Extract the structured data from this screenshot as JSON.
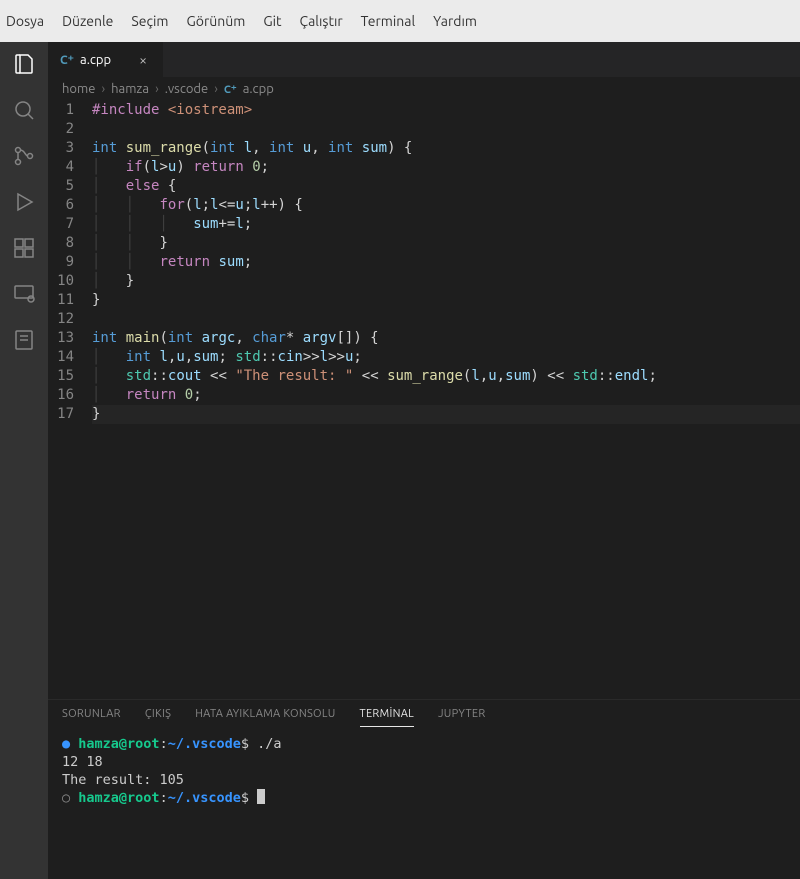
{
  "menubar": [
    "Dosya",
    "Düzenle",
    "Seçim",
    "Görünüm",
    "Git",
    "Çalıştır",
    "Terminal",
    "Yardım"
  ],
  "tab": {
    "icon_label": "C⁺",
    "filename": "a.cpp"
  },
  "breadcrumbs": {
    "parts": [
      "home",
      "hamza",
      ".vscode"
    ],
    "icon_label": "C⁺",
    "file": "a.cpp"
  },
  "code": {
    "line_count": 17,
    "lines": [
      [
        [
          "pp",
          "#include "
        ],
        [
          "inc",
          "<iostream>"
        ]
      ],
      [],
      [
        [
          "kw",
          "int "
        ],
        [
          "fn",
          "sum_range"
        ],
        [
          "pun",
          "("
        ],
        [
          "kw",
          "int "
        ],
        [
          "var",
          "l"
        ],
        [
          "pun",
          ", "
        ],
        [
          "kw",
          "int "
        ],
        [
          "var",
          "u"
        ],
        [
          "pun",
          ", "
        ],
        [
          "kw",
          "int "
        ],
        [
          "var",
          "sum"
        ],
        [
          "pun",
          ") {"
        ]
      ],
      [
        [
          "ws",
          "    "
        ],
        [
          "ctrl",
          "if"
        ],
        [
          "pun",
          "("
        ],
        [
          "var",
          "l"
        ],
        [
          "op",
          ">"
        ],
        [
          "var",
          "u"
        ],
        [
          "pun",
          ") "
        ],
        [
          "ctrl",
          "return"
        ],
        [
          "pun",
          " "
        ],
        [
          "num",
          "0"
        ],
        [
          "pun",
          ";"
        ]
      ],
      [
        [
          "ws",
          "    "
        ],
        [
          "ctrl",
          "else"
        ],
        [
          "pun",
          " {"
        ]
      ],
      [
        [
          "ws",
          "        "
        ],
        [
          "ctrl",
          "for"
        ],
        [
          "pun",
          "("
        ],
        [
          "var",
          "l"
        ],
        [
          "pun",
          ";"
        ],
        [
          "var",
          "l"
        ],
        [
          "op",
          "<="
        ],
        [
          "var",
          "u"
        ],
        [
          "pun",
          ";"
        ],
        [
          "var",
          "l"
        ],
        [
          "op",
          "++"
        ],
        [
          "pun",
          ") {"
        ]
      ],
      [
        [
          "ws",
          "            "
        ],
        [
          "var",
          "sum"
        ],
        [
          "op",
          "+="
        ],
        [
          "var",
          "l"
        ],
        [
          "pun",
          ";"
        ]
      ],
      [
        [
          "ws",
          "        "
        ],
        [
          "pun",
          "}"
        ]
      ],
      [
        [
          "ws",
          "        "
        ],
        [
          "ctrl",
          "return"
        ],
        [
          "pun",
          " "
        ],
        [
          "var",
          "sum"
        ],
        [
          "pun",
          ";"
        ]
      ],
      [
        [
          "ws",
          "    "
        ],
        [
          "pun",
          "}"
        ]
      ],
      [
        [
          "pun",
          "}"
        ]
      ],
      [],
      [
        [
          "kw",
          "int "
        ],
        [
          "fn",
          "main"
        ],
        [
          "pun",
          "("
        ],
        [
          "kw",
          "int "
        ],
        [
          "var",
          "argc"
        ],
        [
          "pun",
          ", "
        ],
        [
          "kw",
          "char"
        ],
        [
          "op",
          "* "
        ],
        [
          "var",
          "argv"
        ],
        [
          "pun",
          "[]) {"
        ]
      ],
      [
        [
          "ws",
          "    "
        ],
        [
          "kw",
          "int "
        ],
        [
          "var",
          "l"
        ],
        [
          "pun",
          ","
        ],
        [
          "var",
          "u"
        ],
        [
          "pun",
          ","
        ],
        [
          "var",
          "sum"
        ],
        [
          "pun",
          "; "
        ],
        [
          "ns",
          "std"
        ],
        [
          "pun",
          "::"
        ],
        [
          "var",
          "cin"
        ],
        [
          "op",
          ">>"
        ],
        [
          "var",
          "l"
        ],
        [
          "op",
          ">>"
        ],
        [
          "var",
          "u"
        ],
        [
          "pun",
          ";"
        ]
      ],
      [
        [
          "ws",
          "    "
        ],
        [
          "ns",
          "std"
        ],
        [
          "pun",
          "::"
        ],
        [
          "var",
          "cout"
        ],
        [
          "op",
          " << "
        ],
        [
          "str",
          "\"The result: \""
        ],
        [
          "op",
          " << "
        ],
        [
          "fn",
          "sum_range"
        ],
        [
          "pun",
          "("
        ],
        [
          "var",
          "l"
        ],
        [
          "pun",
          ","
        ],
        [
          "var",
          "u"
        ],
        [
          "pun",
          ","
        ],
        [
          "var",
          "sum"
        ],
        [
          "pun",
          ")"
        ],
        [
          "op",
          " << "
        ],
        [
          "ns",
          "std"
        ],
        [
          "pun",
          "::"
        ],
        [
          "var",
          "endl"
        ],
        [
          "pun",
          ";"
        ]
      ],
      [
        [
          "ws",
          "    "
        ],
        [
          "ctrl",
          "return"
        ],
        [
          "pun",
          " "
        ],
        [
          "num",
          "0"
        ],
        [
          "pun",
          ";"
        ]
      ],
      [
        [
          "pun",
          "}"
        ]
      ]
    ]
  },
  "panel": {
    "tabs": [
      "SORUNLAR",
      "ÇIKIŞ",
      "HATA AYIKLAMA KONSOLU",
      "TERMİNAL",
      "JUPYTER"
    ],
    "active_tab": "TERMİNAL"
  },
  "terminal": {
    "prompt_user": "hamza@root",
    "prompt_sep": ":",
    "prompt_path": "~/.vscode",
    "prompt_end": "$",
    "lines": [
      {
        "type": "prompt",
        "bullet": "filled",
        "cmd": " ./a"
      },
      {
        "type": "out",
        "text": "12 18"
      },
      {
        "type": "out",
        "text": "The result: 105"
      },
      {
        "type": "prompt",
        "bullet": "empty",
        "cmd": " ",
        "cursor": true
      }
    ]
  }
}
